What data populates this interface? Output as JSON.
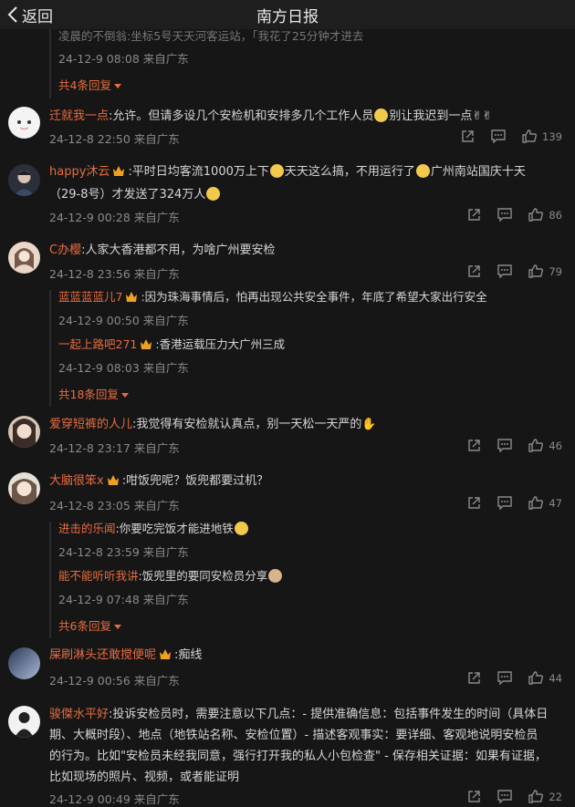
{
  "header": {
    "back_label": "返回",
    "title": "南方日报"
  },
  "top_partial": {
    "text": "凌晨的不倒翁:坐标5号天天河客运站，「我花了25分钟才进去",
    "time": "24-12-9 08:08 来自广东",
    "more": "共4条回复"
  },
  "comments": [
    {
      "user": "迁就我一点",
      "text": ":允许。但请多设几个安检机和安排多几个工作人员",
      "tail": "别让我迟到一点",
      "time": "24-12-8 22:50 来自广东",
      "likes": "139"
    },
    {
      "user": "happy沐云",
      "text": ":平时日均客流1000万上下",
      "text2": "天天这么搞，不用运行了",
      "text3": "广州南站国庆十天",
      "line2": "（29-8号）才发送了324万人",
      "time": "24-12-9 00:28 来自广东",
      "likes": "86"
    },
    {
      "user": "C办樱",
      "text": ":人家大香港都不用，为啥广州要安检",
      "time": "24-12-8 23:56 来自广东",
      "likes": "79",
      "replies": [
        {
          "user": "蓝蓝蓝蓝儿7",
          "text": ":因为珠海事情后，怕再出现公共安全事件，年底了希望大家出行安全",
          "time": "24-12-9 00:50 来自广东"
        },
        {
          "user": "一起上路吧271",
          "text": ":香港运载压力大广州三成",
          "time": "24-12-9 08:03 来自广东"
        }
      ],
      "more": "共18条回复"
    },
    {
      "user": "爱穿短裤的人儿",
      "text": ":我觉得有安检就认真点，别一天松一天严的",
      "time": "24-12-8 23:17 来自广东",
      "likes": "46"
    },
    {
      "user": "大脑很笨x",
      "text": ":咁饭兜呢？饭兜都要过机？",
      "time": "24-12-8 23:05 来自广东",
      "likes": "47",
      "replies": [
        {
          "user": "进击的乐闻",
          "text": ":你要吃完饭才能进地铁",
          "time": "24-12-8 23:59 来自广东"
        },
        {
          "user": "能不能听听我讲",
          "text": ":饭兜里的要同安检员分享",
          "time": "24-12-9 07:48 来自广东"
        }
      ],
      "more": "共6条回复"
    },
    {
      "user": "屎刷淋头还敢搅便呢",
      "text": ":痴线",
      "time": "24-12-9 00:56 来自广东",
      "likes": "44"
    },
    {
      "user": "骏傑水平好",
      "text": ":投诉安检员时，需要注意以下几点：- 提供准确信息：包括事件发生的时间（具体日",
      "line2": "期、大概时段）、地点（地铁站名称、安检位置）- 描述客观事实：要详细、客观地说明安检员",
      "line3": "的行为。比如\"安检员未经我同意，强行打开我的私人小包检查\" - 保存相关证据：如果有证据，",
      "line4": "比如现场的照片、视频，或者能证明",
      "time": "24-12-9 00:49 来自广东",
      "likes": "22"
    }
  ],
  "colors": {
    "accent": "#e86c40",
    "background": "#161616",
    "muted": "#8a8a8a"
  }
}
